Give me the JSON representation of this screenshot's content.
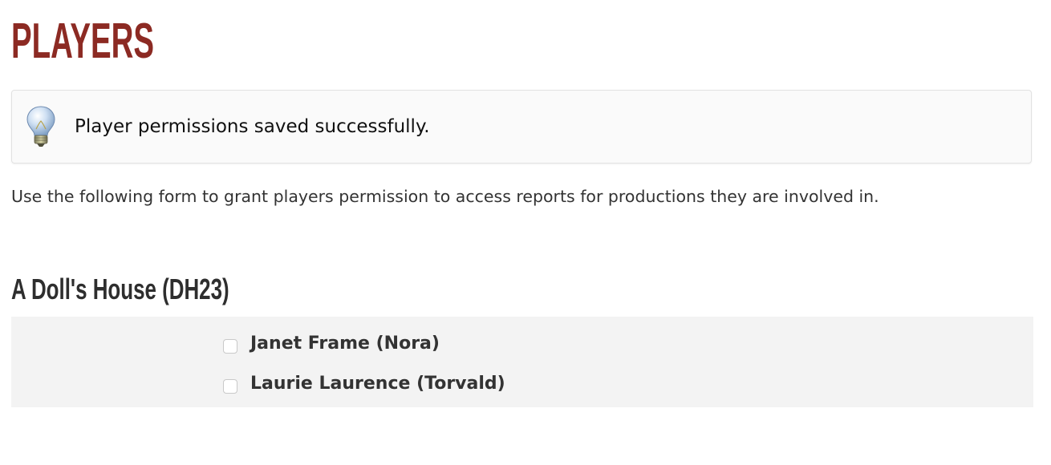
{
  "page": {
    "title": "PLAYERS"
  },
  "notice": {
    "icon": "lightbulb-icon",
    "message": "Player permissions saved successfully."
  },
  "intro": {
    "text": "Use the following form to grant players permission to access reports for productions they are involved in."
  },
  "production": {
    "title": "A Doll's House (DH23)",
    "players": [
      {
        "label": "Janet Frame (Nora)",
        "checked": false
      },
      {
        "label": "Laurie Laurence (Torvald)",
        "checked": false
      }
    ]
  },
  "colors": {
    "title": "#8c2a23",
    "panel_background": "#f3f3f3",
    "notice_background": "#fafafa"
  }
}
